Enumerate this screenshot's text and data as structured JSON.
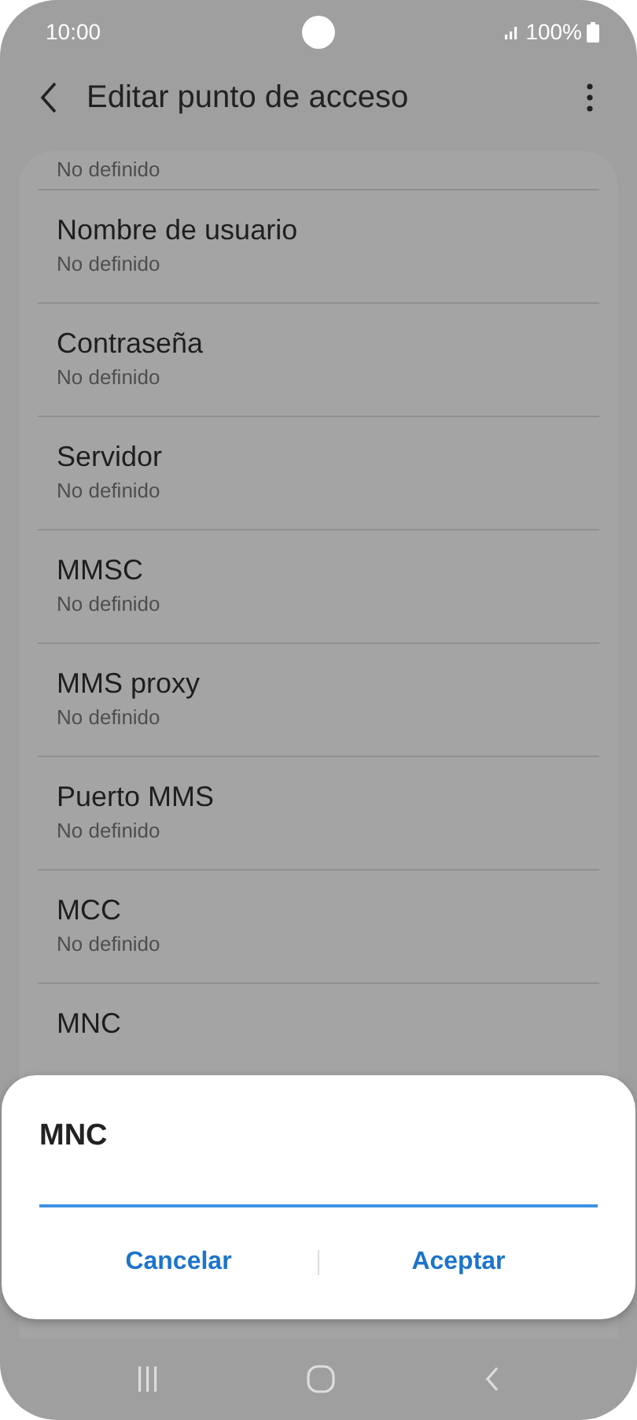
{
  "status_bar": {
    "time": "10:00",
    "battery": "100%"
  },
  "header": {
    "title": "Editar punto de acceso"
  },
  "settings": [
    {
      "subtitle": "No definido"
    },
    {
      "title": "Nombre de usuario",
      "subtitle": "No definido"
    },
    {
      "title": "Contraseña",
      "subtitle": "No definido"
    },
    {
      "title": "Servidor",
      "subtitle": "No definido"
    },
    {
      "title": "MMSC",
      "subtitle": "No definido"
    },
    {
      "title": "MMS proxy",
      "subtitle": "No definido"
    },
    {
      "title": "Puerto MMS",
      "subtitle": "No definido"
    },
    {
      "title": "MCC",
      "subtitle": "No definido"
    },
    {
      "title": "MNC"
    }
  ],
  "dialog": {
    "title": "MNC",
    "buttons": [
      "Cancelar",
      "Aceptar"
    ]
  }
}
